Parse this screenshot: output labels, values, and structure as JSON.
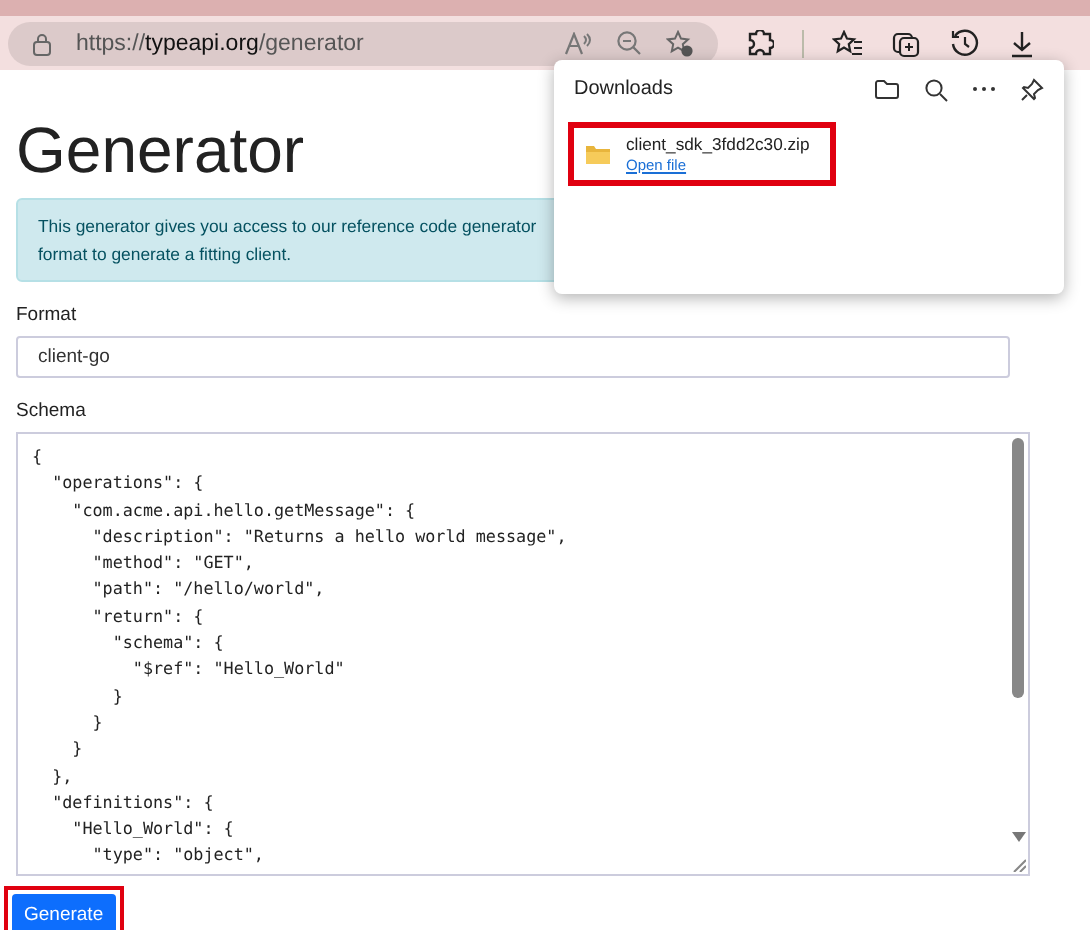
{
  "browser": {
    "url_scheme": "https://",
    "url_host": "typeapi.org",
    "url_path": "/generator"
  },
  "downloads": {
    "title": "Downloads",
    "items": [
      {
        "file": "client_sdk_3fdd2c30.zip",
        "action": "Open file",
        "highlighted": true
      }
    ]
  },
  "page": {
    "title": "Generator",
    "info_lines": [
      "This generator gives you access to our reference code generator",
      "format to generate a fitting client."
    ],
    "format": {
      "label": "Format",
      "value": "client-go"
    },
    "schema": {
      "label": "Schema",
      "lines": [
        "{",
        "  \"operations\": {",
        "    \"com.acme.api.hello.getMessage\": {",
        "      \"description\": \"Returns a hello world message\",",
        "      \"method\": \"GET\",",
        "      \"path\": \"/hello/world\",",
        "      \"return\": {",
        "        \"schema\": {",
        "          \"$ref\": \"Hello_World\"",
        "        }",
        "      }",
        "    }",
        "  },",
        "  \"definitions\": {",
        "    \"Hello_World\": {",
        "      \"type\": \"object\","
      ]
    },
    "generate": {
      "label": "Generate",
      "highlighted": true
    }
  }
}
